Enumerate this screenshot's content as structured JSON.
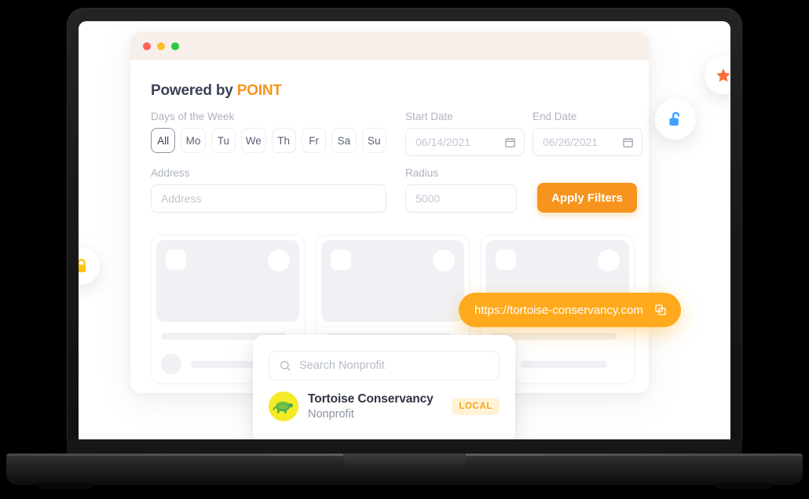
{
  "window": {
    "traffic_lights": [
      "red",
      "yellow",
      "green"
    ]
  },
  "brand": {
    "prefix": "Powered by ",
    "name": "POINT"
  },
  "filters": {
    "days_label": "Days of the Week",
    "days": [
      {
        "label": "All",
        "selected": true
      },
      {
        "label": "Mo",
        "selected": false
      },
      {
        "label": "Tu",
        "selected": false
      },
      {
        "label": "We",
        "selected": false
      },
      {
        "label": "Th",
        "selected": false
      },
      {
        "label": "Fr",
        "selected": false
      },
      {
        "label": "Sa",
        "selected": false
      },
      {
        "label": "Su",
        "selected": false
      }
    ],
    "start_date_label": "Start Date",
    "start_date_value": "06/14/2021",
    "end_date_label": "End Date",
    "end_date_value": "06/26/2021",
    "address_label": "Address",
    "address_placeholder": "Address",
    "radius_label": "Radius",
    "radius_placeholder": "5000",
    "apply_label": "Apply Filters"
  },
  "url_pill": {
    "url": "https://tortoise-conservancy.com",
    "copy_icon": "copy-icon"
  },
  "search_popover": {
    "search_placeholder": "Search Nonprofit",
    "search_icon": "search-icon",
    "result": {
      "icon": "turtle-icon",
      "name": "Tortoise Conservancy",
      "subtitle": "Nonprofit",
      "badge": "LOCAL"
    }
  },
  "floating_icons": [
    {
      "name": "star-icon",
      "color": "#fb6d3a"
    },
    {
      "name": "unlock-icon",
      "color": "#3fa0ff"
    },
    {
      "name": "lock-icon",
      "color": "#ffc20e"
    }
  ],
  "colors": {
    "accent_orange": "#f7941e",
    "pill_orange": "#ffaa1d",
    "titlebar_cream": "#f7efe9",
    "badge_bg": "#fff3d6",
    "turtle_bg": "#f5ea26",
    "turtle_body": "#4caf50"
  },
  "skeleton_cards": [
    {
      "id": "card-1"
    },
    {
      "id": "card-2"
    },
    {
      "id": "card-3"
    }
  ]
}
